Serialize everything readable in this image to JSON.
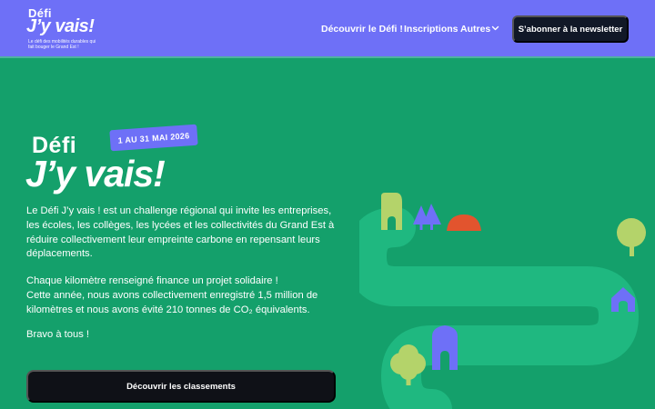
{
  "header": {
    "logo": {
      "line1": "Défi",
      "line2": "J’y vais!",
      "tagline": "Le défi des mobilités durables qui fait bouger le Grand Est !"
    },
    "nav": [
      {
        "label": "Découvrir le Défi !"
      },
      {
        "label": "Inscriptions"
      },
      {
        "label": "Autres"
      }
    ],
    "newsletter_label": "S’abonner à la newsletter"
  },
  "hero": {
    "logo_line1": "Défi",
    "logo_line2": "J’y vais!",
    "date_badge": "1 AU 31 MAI 2026",
    "paragraph1": "Le Défi J’y vais ! est un challenge régional qui invite les entreprises, les écoles, les collèges, les lycées et les collectivités du Grand Est à réduire collectivement leur empreinte carbone en repensant leurs déplacements.",
    "paragraph2_line1": "Chaque kilomètre renseigné finance un projet solidaire !",
    "paragraph2_line2": "Cette année, nous avons collectivement enregistré 1,5 million de kilomètres et nous avons évité 210 tonnes de CO₂ équivalents.",
    "paragraph3": "Bravo à tous !",
    "cta_label": "Découvrir les classements"
  },
  "colors": {
    "header_bg": "#6e70f7",
    "hero_bg": "#14a06b",
    "road": "#1fb880",
    "dark_button": "#111827",
    "house_lime": "#b4d36a",
    "house_blue": "#6e70f7",
    "tree_blue": "#6e70f7",
    "roof_red": "#e2542e",
    "tree_lime": "#b4d36a"
  },
  "icons": {
    "chevron": "chevron-down-icon",
    "illustration": [
      "house-icon",
      "tree-icon",
      "dome-icon",
      "road-illustration"
    ]
  }
}
